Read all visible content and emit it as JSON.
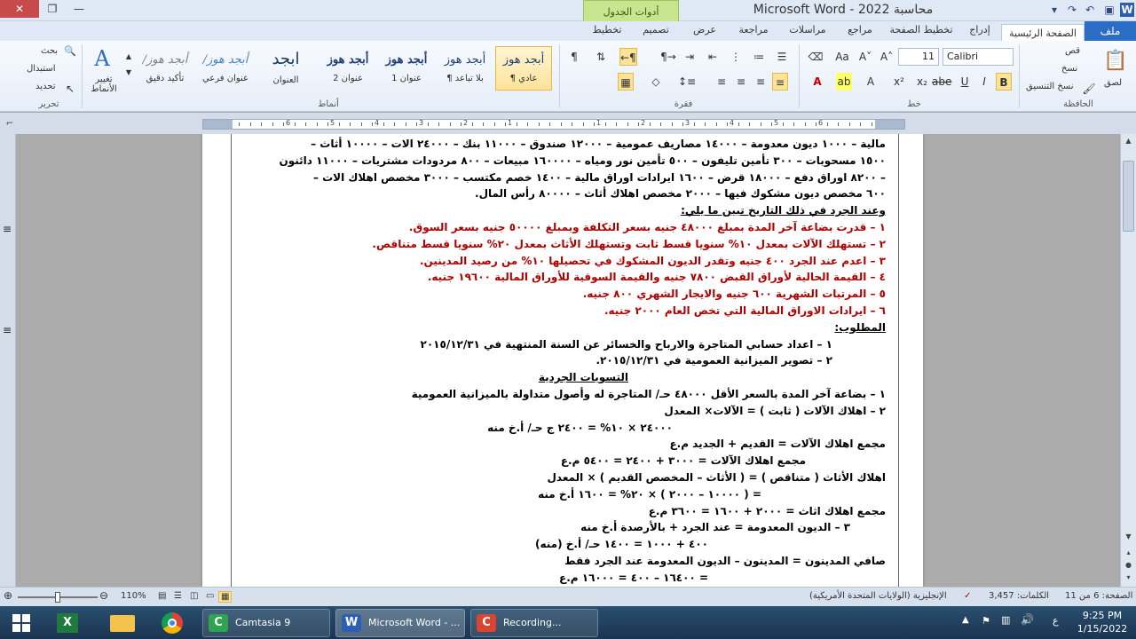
{
  "window": {
    "title": "Microsoft Word - 2022 محاسبة",
    "context_tab_group": "أدوات الجدول"
  },
  "ribbon_tabs": [
    "ملف",
    "الصفحة الرئيسية",
    "إدراج",
    "تخطيط الصفحة",
    "مراجع",
    "مراسلات",
    "مراجعة",
    "عرض",
    "تصميم",
    "تخطيط"
  ],
  "ribbon": {
    "clipboard": {
      "label": "الحافظة",
      "paste": "لصق",
      "cut": "قص",
      "copy": "نسخ",
      "format_painter": "نسخ التنسيق"
    },
    "font": {
      "label": "خط",
      "font_name": "Calibri",
      "font_size": "11"
    },
    "paragraph": {
      "label": "فقرة"
    },
    "styles": {
      "label": "أنماط",
      "items": [
        {
          "sample": "أبجد هوز",
          "name": "¶ عادي"
        },
        {
          "sample": "أبجد هوز",
          "name": "¶ بلا تباعد"
        },
        {
          "sample": "أبجد هوز",
          "name": "عنوان 1"
        },
        {
          "sample": "أبجد هوز",
          "name": "عنوان 2"
        },
        {
          "sample": "ابجد",
          "name": "العنوان"
        },
        {
          "sample": "/أبجد هوز",
          "name": "عنوان فرعي"
        },
        {
          "sample": "/أبجد هوز",
          "name": "تأكيد دقيق"
        }
      ],
      "change_styles": "تغيير الأنماط"
    },
    "editing": {
      "label": "تحرير",
      "find": "بحث",
      "replace": "استبدال",
      "select": "تحديد"
    }
  },
  "ruler": {
    "numbers": [
      "6",
      "5",
      "4",
      "3",
      "2",
      "1",
      "1",
      "2",
      "3",
      "4",
      "5",
      "6"
    ]
  },
  "document": {
    "lines": [
      {
        "text": "مالية – ١٠٠٠ ديون معدومة – ١٤٠٠٠ مصاريف عمومية – ١٢٠٠٠ صندوق – ١١٠٠٠ بنك – ٢٤٠٠٠ الات – ١٠٠٠٠ أثاث –",
        "color": "black"
      },
      {
        "text": "١٥٠٠ مسحوبات – ٣٠٠ تأمين تليفون – ٥٠٠ تأمين نور ومياه – ١٦٠٠٠٠ مبيعات – ٨٠٠ مردودات مشتريات – ١١٠٠٠ دائنون",
        "color": "black"
      },
      {
        "text": "– ٨٢٠٠ اوراق دفع – ١٨٠٠٠ قرض – ١٦٠٠ ايرادات اوراق مالية – ١٤٠٠ خصم مكتسب – ٣٠٠٠ مخصص اهلاك الات –",
        "color": "black"
      },
      {
        "text": "٦٠٠ مخصص ديون مشكوك فيها – ٢٠٠٠ مخصص اهلاك أثاث – ٨٠٠٠٠ رأس المال.",
        "color": "black"
      },
      {
        "text": "وعند الجرد في ذلك التاريخ تبين ما يلي:",
        "color": "black",
        "underline": true
      },
      {
        "text": "١ – قدرت بضاعة آخر المدة بمبلغ ٤٨٠٠٠ جنيه بسعر التكلفة وبمبلغ ٥٠٠٠٠ جنيه بسعر السوق.",
        "color": "red"
      },
      {
        "text": "٢ – تستهلك الآلات بمعدل ١٠% سنويا قسط ثابت وتستهلك الأثاث بمعدل ٢٠% سنويا قسط متناقص.",
        "color": "red"
      },
      {
        "text": "٣ – اعدم عند الجرد ٤٠٠ جنيه وتقدر الديون المشكوك في تحصيلها ١٠% من رصيد المدينين.",
        "color": "red"
      },
      {
        "text": "٤ – القيمة الحالية لأوراق القبض ٧٨٠٠ جنيه والقيمة السوقية للأوراق المالية ١٩٦٠٠ جنيه.",
        "color": "red"
      },
      {
        "text": "٥ – المرتبات الشهرية ٦٠٠ جنيه والايجار الشهري ٨٠٠ جنيه.",
        "color": "red"
      },
      {
        "text": "٦ – ايرادات الاوراق المالية التي تخص العام ٢٠٠٠ جنيه.",
        "color": "red"
      },
      {
        "text": "المطلوب:",
        "color": "black",
        "underline": true
      },
      {
        "text": "١ – اعداد حسابي المتاجرة والارباح والخسائر عن السنة المنتهية في ٢٠١٥/١٢/٣١",
        "color": "black",
        "indent": 60
      },
      {
        "text": "٢ – تصوير الميزانية العمومية في ٢٠١٥/١٢/٣١.",
        "color": "black",
        "indent": 60
      },
      {
        "text": "التسويات الجردية",
        "color": "black",
        "underline": true,
        "indent": 290
      },
      {
        "text": "١ – بضاعة آخر المدة بالسعر الأقل ٤٨٠٠٠ حـ/ المتاجرة له وأصول متداولة بالميزانية العمومية",
        "color": "black"
      },
      {
        "text": "٢ – اهلاك الآلات ( ثابت ) = الآلات× المعدل",
        "color": "black"
      },
      {
        "text": "٢٤٠٠٠ × ١٠% = ٢٤٠٠ ج حـ/ أ.خ منه",
        "color": "black",
        "indent": 240
      },
      {
        "text": "مجمع اهلاك الآلات = القديم + الجديد م.ع",
        "color": "black"
      },
      {
        "text": "مجمع اهلاك الآلات = ٣٠٠٠ + ٢٤٠٠ = ٥٤٠٠ م.ع",
        "color": "black",
        "indent": 90
      },
      {
        "text": "اهلاك الأثاث ( متناقص ) = ( الأثاث – المخصص القديم ) × المعدل",
        "color": "black"
      },
      {
        "text": "= ( ١٠٠٠٠ – ٢٠٠٠ ) × ٢٠% = ١٦٠٠ أ.خ منه",
        "color": "black",
        "indent": 140
      },
      {
        "text": "مجمع اهلاك اثاث = ٢٠٠٠ + ١٦٠٠ = ٣٦٠٠ م.ع",
        "color": "black"
      },
      {
        "text": "٣ – الديون المعدومة = عند الجرد + بالأرصدة أ.خ منه",
        "color": "black",
        "indent": 40
      },
      {
        "text": "٤٠٠ + ١٠٠٠ = ١٤٠٠ حـ/ أ.خ (منه)",
        "color": "black",
        "indent": 200
      },
      {
        "text": "صافي المدينون = المدينون – الديون المعدومة عند الجرد فقط",
        "color": "black"
      },
      {
        "text": "= ١٦٤٠٠ – ٤٠٠ = ١٦٠٠٠ م.ع",
        "color": "black",
        "indent": 200
      }
    ]
  },
  "statusbar": {
    "page": "الصفحة: 6 من 11",
    "words": "الكلمات: 3,457",
    "language": "الإنجليزية (الولايات المتحدة الأمريكية)",
    "zoom": "110%"
  },
  "taskbar": {
    "tasks": [
      {
        "label": "Camtasia 9",
        "icon": "camtasia-icon",
        "color": "#2ea44f"
      },
      {
        "label": "Microsoft Word - ...",
        "icon": "word-icon",
        "color": "#2b5fb3"
      },
      {
        "label": "Recording...",
        "icon": "record-icon",
        "color": "#d9452f"
      }
    ],
    "time": "9:25 PM",
    "date": "1/15/2022",
    "lang": "ع"
  }
}
